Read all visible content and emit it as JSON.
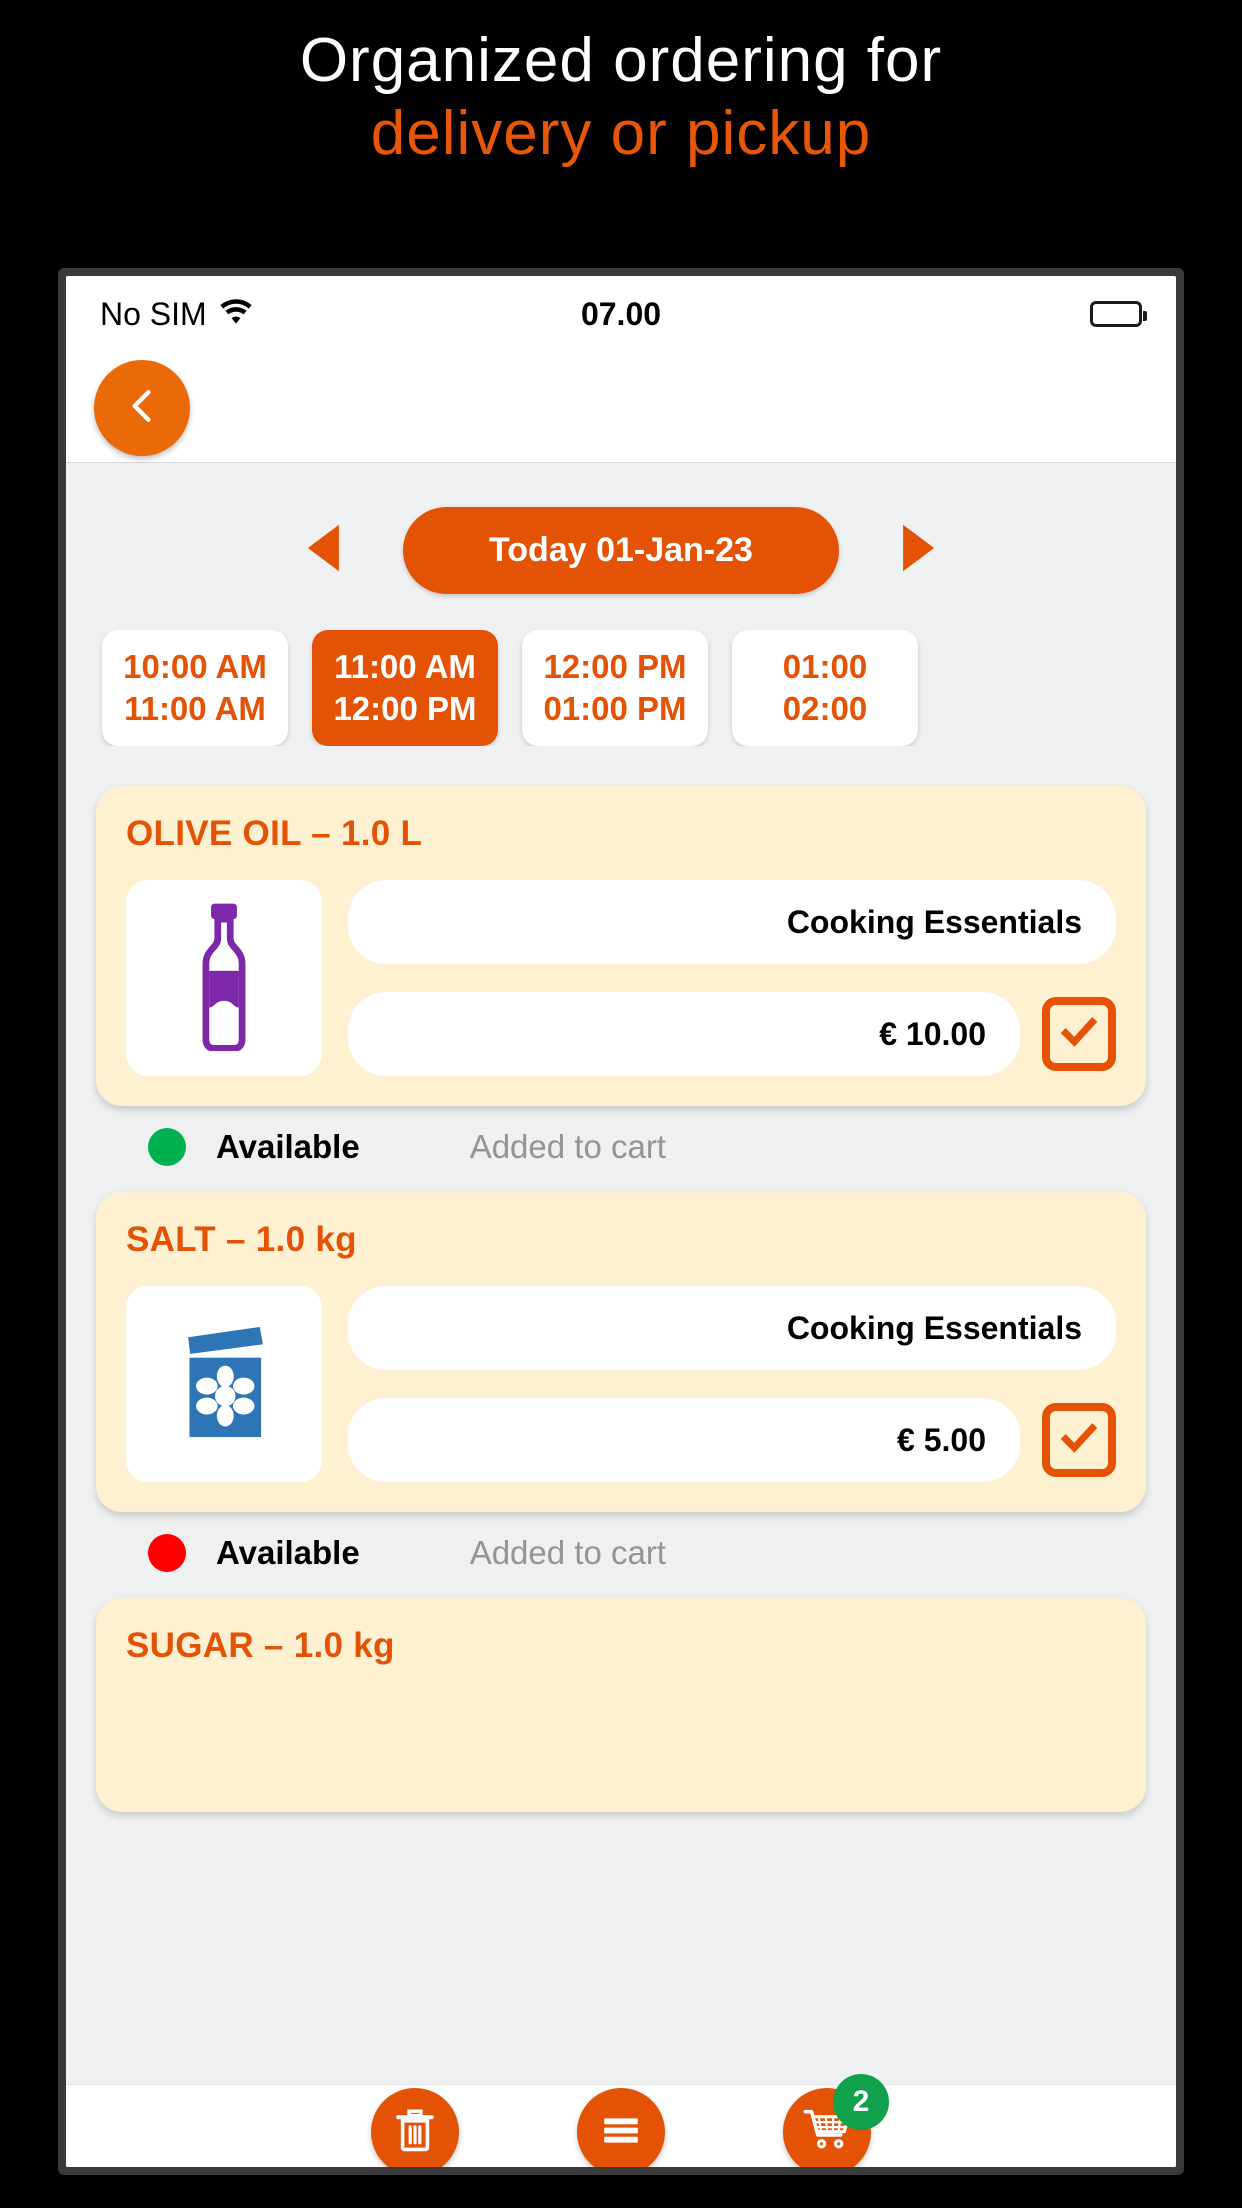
{
  "promo": {
    "line1": "Organized ordering for",
    "line2": "delivery or pickup"
  },
  "status_bar": {
    "carrier": "No SIM",
    "time": "07.00"
  },
  "header": {
    "back_label": "Back"
  },
  "date_nav": {
    "prev_label": "Previous day",
    "next_label": "Next day",
    "current": "Today 01-Jan-23"
  },
  "time_slots": [
    {
      "start": "10:00 AM",
      "end": "11:00 AM",
      "selected": false
    },
    {
      "start": "11:00 AM",
      "end": "12:00 PM",
      "selected": true
    },
    {
      "start": "12:00 PM",
      "end": "01:00 PM",
      "selected": false
    },
    {
      "start": "01:00",
      "end": "02:00",
      "selected": false
    }
  ],
  "products": [
    {
      "title": "OLIVE OIL – 1.0 L",
      "icon": "bottle-icon",
      "category": "Cooking Essentials",
      "price": "€ 10.00",
      "checked": true,
      "availability": "Available",
      "availability_color": "#00B14F",
      "cart_note": "Added to cart"
    },
    {
      "title": "SALT – 1.0 kg",
      "icon": "salt-box-icon",
      "category": "Cooking Essentials",
      "price": "€ 5.00",
      "checked": true,
      "availability": "Available",
      "availability_color": "#FF0000",
      "cart_note": "Added to cart"
    },
    {
      "title": "SUGAR – 1.0 kg",
      "icon": "sugar-icon",
      "category": "",
      "price": "",
      "checked": false,
      "availability": "",
      "availability_color": "",
      "cart_note": ""
    }
  ],
  "bottom_nav": [
    {
      "name": "delete-button",
      "icon": "trash-icon",
      "badge": ""
    },
    {
      "name": "menu-button",
      "icon": "hamburger-menu-icon",
      "badge": ""
    },
    {
      "name": "cart-button",
      "icon": "shopping-cart-icon",
      "badge": "2"
    }
  ],
  "colors": {
    "accent": "#E35205",
    "card_bg": "#FDF1D2",
    "bottle_purple": "#7D28A8",
    "salt_blue": "#2E75B6",
    "badge_green": "#11A04B"
  }
}
